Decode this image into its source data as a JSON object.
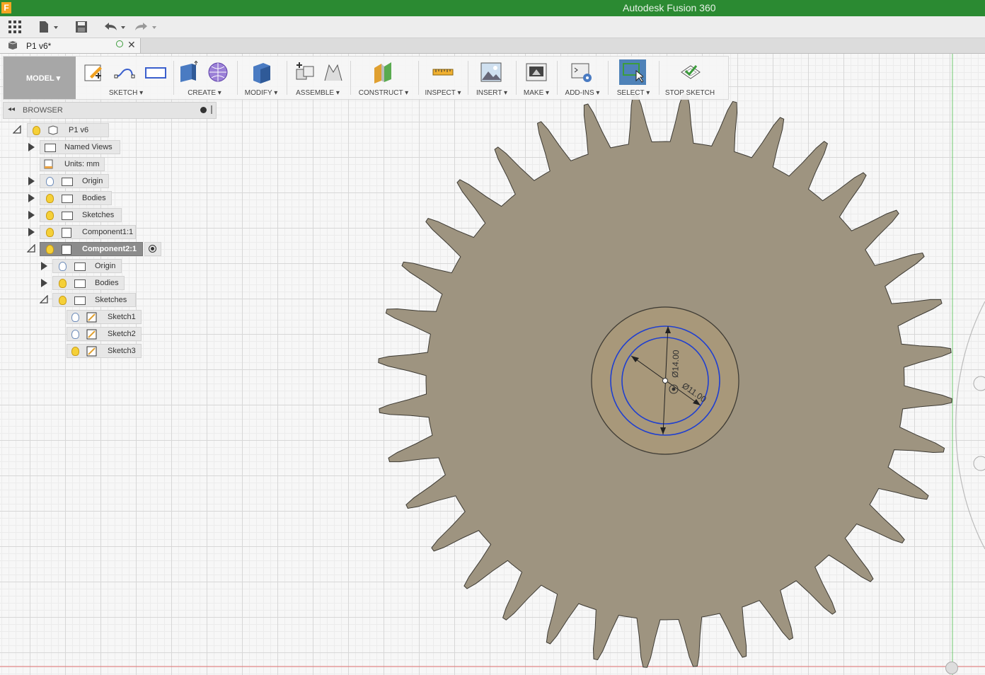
{
  "app": {
    "title": "Autodesk Fusion 360",
    "icon_letter": "F"
  },
  "document_tab": {
    "name": "P1 v6*"
  },
  "toolbar": {
    "workspace": "MODEL ▾",
    "groups": [
      {
        "label": "SKETCH ▾"
      },
      {
        "label": "CREATE ▾"
      },
      {
        "label": "MODIFY ▾"
      },
      {
        "label": "ASSEMBLE ▾"
      },
      {
        "label": "CONSTRUCT ▾"
      },
      {
        "label": "INSPECT ▾"
      },
      {
        "label": "INSERT ▾"
      },
      {
        "label": "MAKE ▾"
      },
      {
        "label": "ADD-INS ▾"
      },
      {
        "label": "SELECT ▾"
      },
      {
        "label": "STOP SKETCH"
      }
    ]
  },
  "browser": {
    "header": "BROWSER",
    "root": "P1 v6",
    "items": {
      "named_views": "Named Views",
      "units": "Units: mm",
      "origin": "Origin",
      "bodies": "Bodies",
      "sketches": "Sketches",
      "component1": "Component1:1",
      "component2": "Component2:1",
      "c2_origin": "Origin",
      "c2_bodies": "Bodies",
      "c2_sketches": "Sketches",
      "sketch1": "Sketch1",
      "sketch2": "Sketch2",
      "sketch3": "Sketch3"
    }
  },
  "viewport": {
    "dimension_outer": "Ø14.00",
    "dimension_inner": "Ø11.00",
    "gear_teeth": 36,
    "colors": {
      "gear": "#9e9480",
      "hub": "#a8987a",
      "sketch_circle": "#1f3fd0",
      "titlebar": "#2b8a32"
    }
  }
}
